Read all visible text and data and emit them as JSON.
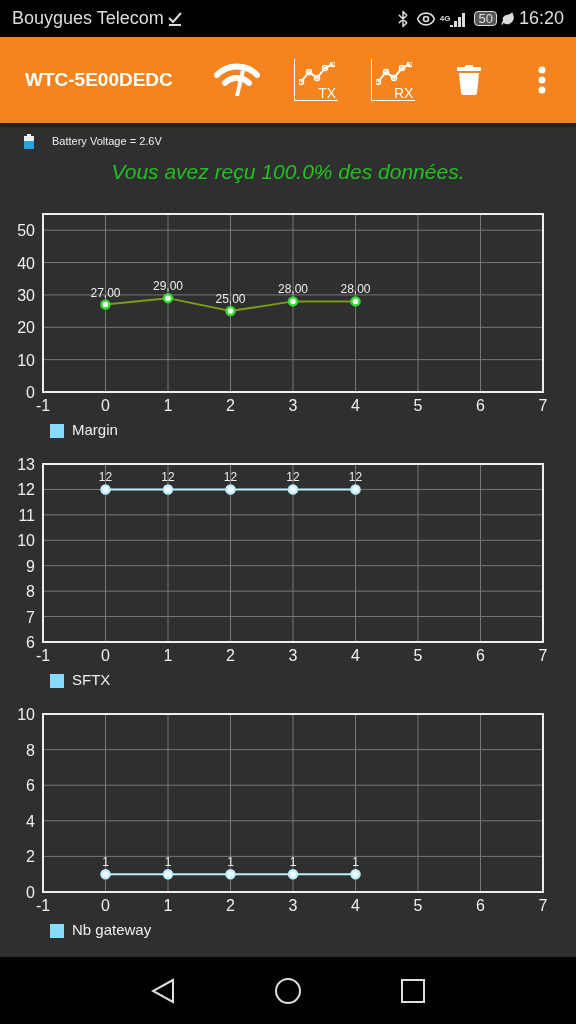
{
  "status_bar": {
    "carrier": "Bouygues Telecom",
    "network": "4G",
    "battery": "50",
    "time": "16:20"
  },
  "toolbar": {
    "title": "WTC-5E00DEDC",
    "actions": [
      {
        "kind": "signal"
      },
      {
        "kind": "chart",
        "label": "TX"
      },
      {
        "kind": "chart",
        "label": "RX"
      },
      {
        "kind": "delete"
      },
      {
        "kind": "more"
      }
    ]
  },
  "battery_voltage": "Battery Voltage = 2.6V",
  "message": "Vous avez reçu 100.0% des données.",
  "charts": [
    {
      "chart_data": {
        "type": "line",
        "x": [
          0,
          1,
          2,
          3,
          4
        ],
        "series": [
          {
            "name": "Margin",
            "color": "#33dd33",
            "marker": "circle",
            "values": [
              27,
              29,
              25,
              28,
              28
            ]
          }
        ],
        "xlim": [
          -1,
          7
        ],
        "ylim": [
          0,
          55
        ],
        "xticks": [
          -1,
          0,
          1,
          2,
          3,
          4,
          5,
          6,
          7
        ],
        "yticks": [
          0,
          10,
          20,
          30,
          40,
          50
        ],
        "grid": true,
        "value_labels": [
          "27,00",
          "29,00",
          "25,00",
          "28,00",
          "28,00"
        ]
      }
    },
    {
      "chart_data": {
        "type": "line",
        "x": [
          0,
          1,
          2,
          3,
          4
        ],
        "series": [
          {
            "name": "SFTX",
            "color": "#bfefff",
            "marker": "circle",
            "values": [
              12,
              12,
              12,
              12,
              12
            ]
          }
        ],
        "xlim": [
          -1,
          7
        ],
        "ylim": [
          6,
          13
        ],
        "xticks": [
          -1,
          0,
          1,
          2,
          3,
          4,
          5,
          6,
          7
        ],
        "yticks": [
          6,
          7,
          8,
          9,
          10,
          11,
          12,
          13
        ],
        "grid": true,
        "value_labels": [
          "12",
          "12",
          "12",
          "12",
          "12"
        ]
      }
    },
    {
      "chart_data": {
        "type": "line",
        "x": [
          0,
          1,
          2,
          3,
          4
        ],
        "series": [
          {
            "name": "Nb gateway",
            "color": "#bfefff",
            "marker": "circle",
            "values": [
              1,
              1,
              1,
              1,
              1
            ]
          }
        ],
        "xlim": [
          -1,
          7
        ],
        "ylim": [
          0,
          10
        ],
        "xticks": [
          -1,
          0,
          1,
          2,
          3,
          4,
          5,
          6,
          7
        ],
        "yticks": [
          0,
          2,
          4,
          6,
          8,
          10
        ],
        "grid": true,
        "value_labels": [
          "1",
          "1",
          "1",
          "1",
          "1"
        ]
      }
    }
  ]
}
